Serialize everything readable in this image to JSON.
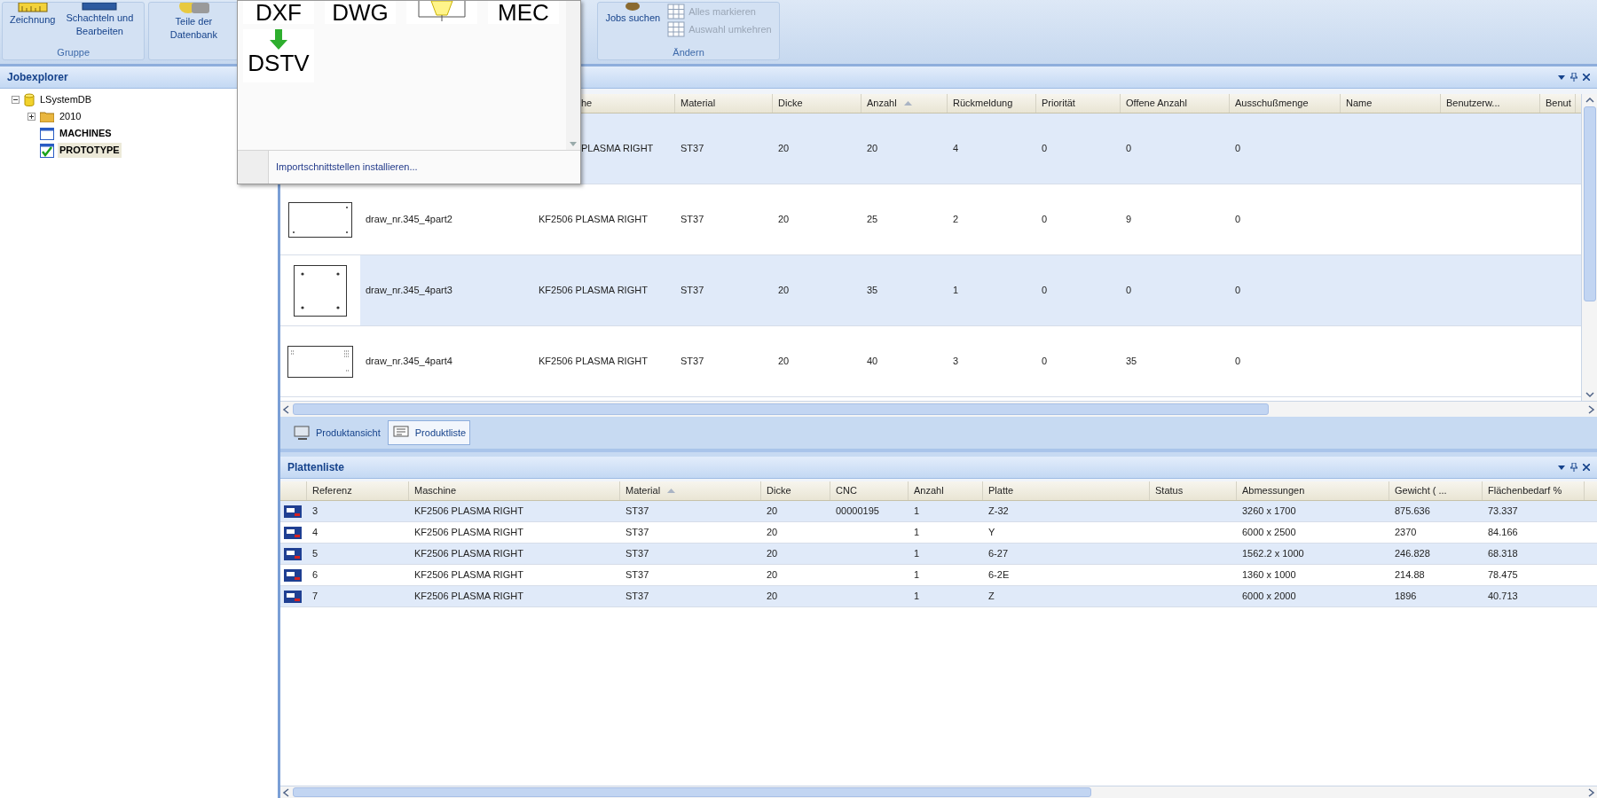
{
  "ribbon": {
    "groups": [
      {
        "label": "Gruppe",
        "buttons": [
          {
            "label": "Zeichnung",
            "kind": "large",
            "disabled": false
          },
          {
            "label": "Schachteln und Bearbeiten",
            "kind": "large",
            "disabled": false
          }
        ]
      },
      {
        "buttons": [
          {
            "label": "Teile der Datenbank",
            "kind": "large",
            "disabled": false
          }
        ]
      },
      {
        "label": "Ändern",
        "buttons": [
          {
            "label": "Jobs suchen",
            "kind": "large",
            "disabled": false
          },
          {
            "label": "Alles markieren",
            "kind": "small",
            "disabled": true
          },
          {
            "label": "Auswahl umkehren",
            "kind": "small",
            "disabled": true
          }
        ]
      }
    ]
  },
  "import_menu": {
    "items": [
      {
        "kind": "text",
        "label": "DXF"
      },
      {
        "kind": "text",
        "label": "DWG"
      },
      {
        "kind": "icon"
      },
      {
        "kind": "text",
        "label": "MEC"
      },
      {
        "kind": "arrow",
        "label": "DSTV"
      }
    ],
    "footer": "Importschnittstellen installieren..."
  },
  "jobexplorer": {
    "title": "Jobexplorer",
    "tree": [
      {
        "label": "LSystemDB",
        "kind": "database",
        "expanded": true,
        "selected": false,
        "children": [
          {
            "label": "2010",
            "kind": "folder",
            "expanded": false,
            "selected": false
          },
          {
            "label": "MACHINES",
            "kind": "table",
            "selected": false
          },
          {
            "label": "PROTOTYPE",
            "kind": "checked",
            "selected": true
          }
        ]
      }
    ]
  },
  "parts_grid": {
    "columns": [
      {
        "label": "he",
        "sorted": false
      },
      {
        "label": "Material",
        "sorted": false
      },
      {
        "label": "Dicke",
        "sorted": false
      },
      {
        "label": "Anzahl",
        "sorted": true
      },
      {
        "label": "Rückmeldung",
        "sorted": false
      },
      {
        "label": "Priorität",
        "sorted": false
      },
      {
        "label": "Offene Anzahl",
        "sorted": false
      },
      {
        "label": "Ausschußmenge",
        "sorted": false
      },
      {
        "label": "Name",
        "sorted": false
      },
      {
        "label": "Benutzerw...",
        "sorted": false
      },
      {
        "label": "Benut",
        "sorted": false
      }
    ],
    "rows": [
      {
        "kind": "partial",
        "cells": [
          "PLASMA RIGHT",
          "ST37",
          "20",
          "20",
          "4",
          "0",
          "0",
          "0"
        ]
      },
      {
        "kind": "wide",
        "name": "draw_nr.345_4part2",
        "cells": [
          "KF2506 PLASMA RIGHT",
          "ST37",
          "20",
          "25",
          "2",
          "0",
          "9",
          "0"
        ]
      },
      {
        "kind": "square",
        "name": "draw_nr.345_4part3",
        "cells": [
          "KF2506 PLASMA RIGHT",
          "ST37",
          "20",
          "35",
          "1",
          "0",
          "0",
          "0"
        ]
      },
      {
        "kind": "slots",
        "name": "draw_nr.345_4part4",
        "cells": [
          "KF2506 PLASMA RIGHT",
          "ST37",
          "20",
          "40",
          "3",
          "0",
          "35",
          "0"
        ]
      }
    ]
  },
  "view_tabs": [
    {
      "label": "Produktansicht",
      "kind": "view",
      "selected": false
    },
    {
      "label": "Produktliste",
      "kind": "list",
      "selected": true
    }
  ],
  "plates": {
    "title": "Plattenliste",
    "columns": [
      {
        "label": "Referenz",
        "sorted": false
      },
      {
        "label": "Maschine",
        "sorted": false
      },
      {
        "label": "Material",
        "sorted": true
      },
      {
        "label": "Dicke",
        "sorted": false
      },
      {
        "label": "CNC",
        "sorted": false
      },
      {
        "label": "Anzahl",
        "sorted": false
      },
      {
        "label": "Platte",
        "sorted": false
      },
      {
        "label": "Status",
        "sorted": false
      },
      {
        "label": "Abmessungen",
        "sorted": false
      },
      {
        "label": "Gewicht ( ...",
        "sorted": false
      },
      {
        "label": "Flächenbedarf %",
        "sorted": false
      }
    ],
    "rows": [
      {
        "cells": [
          "3",
          "KF2506 PLASMA RIGHT",
          "ST37",
          "20",
          "00000195",
          "1",
          "Z-32",
          null,
          "3260 x 1700",
          "875.636",
          "73.337"
        ]
      },
      {
        "cells": [
          "4",
          "KF2506 PLASMA RIGHT",
          "ST37",
          "20",
          null,
          "1",
          "Y",
          null,
          "6000 x 2500",
          "2370",
          "84.166"
        ]
      },
      {
        "cells": [
          "5",
          "KF2506 PLASMA RIGHT",
          "ST37",
          "20",
          null,
          "1",
          "6-27",
          null,
          "1562.2 x 1000",
          "246.828",
          "68.318"
        ]
      },
      {
        "cells": [
          "6",
          "KF2506 PLASMA RIGHT",
          "ST37",
          "20",
          null,
          "1",
          "6-2E",
          null,
          "1360 x 1000",
          "214.88",
          "78.475"
        ]
      },
      {
        "cells": [
          "7",
          "KF2506 PLASMA RIGHT",
          "ST37",
          "20",
          null,
          "1",
          "Z",
          null,
          "6000 x 2000",
          "1896",
          "40.713"
        ]
      }
    ]
  }
}
